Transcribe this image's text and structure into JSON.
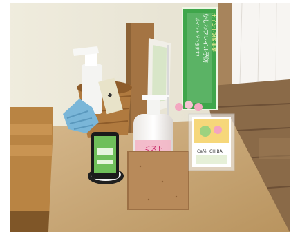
{
  "photo": {
    "subject": "",
    "banner": {
      "line1": "ポイントがつきます！",
      "line2": "かしわフレイル予防",
      "line3": "ポイント対象事業"
    },
    "bottle_label": "ミスト",
    "pop_card": {
      "logo": "Café",
      "brand": "CHIBA"
    },
    "colors": {
      "wall": "#ece8d8",
      "table": "#c9a878",
      "floor": "#8a6a48",
      "banner_green": "#3fa64b",
      "cork": "#b88a5a"
    }
  }
}
